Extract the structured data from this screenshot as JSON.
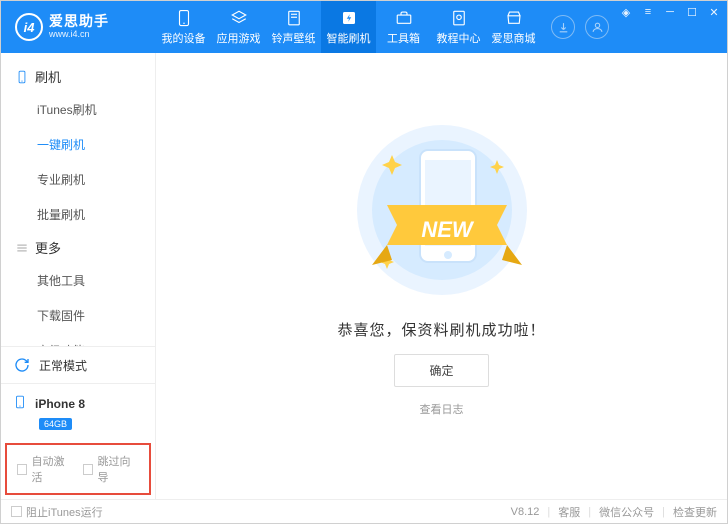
{
  "app": {
    "name": "爱思助手",
    "site": "www.i4.cn",
    "logo_text": "i4"
  },
  "nav": [
    {
      "label": "我的设备",
      "icon": "device"
    },
    {
      "label": "应用游戏",
      "icon": "apps"
    },
    {
      "label": "铃声壁纸",
      "icon": "music"
    },
    {
      "label": "智能刷机",
      "icon": "flash",
      "active": true
    },
    {
      "label": "工具箱",
      "icon": "toolbox"
    },
    {
      "label": "教程中心",
      "icon": "help"
    },
    {
      "label": "爱思商城",
      "icon": "store"
    }
  ],
  "sidebar": {
    "sections": [
      {
        "title": "刷机",
        "icon": "phone",
        "items": [
          "iTunes刷机",
          "一键刷机",
          "专业刷机",
          "批量刷机"
        ],
        "active_index": 1
      },
      {
        "title": "更多",
        "icon": "more",
        "items": [
          "其他工具",
          "下载固件",
          "高级功能"
        ]
      }
    ],
    "mode": {
      "label": "正常模式"
    },
    "device": {
      "name": "iPhone 8",
      "storage": "64GB"
    },
    "checks": {
      "auto_activate": "自动激活",
      "skip_guide": "跳过向导"
    }
  },
  "main": {
    "banner_text": "NEW",
    "success": "恭喜您，保资料刷机成功啦！",
    "ok": "确定",
    "log": "查看日志"
  },
  "footer": {
    "block_itunes": "阻止iTunes运行",
    "version": "V8.12",
    "links": [
      "客服",
      "微信公众号",
      "检查更新"
    ]
  }
}
